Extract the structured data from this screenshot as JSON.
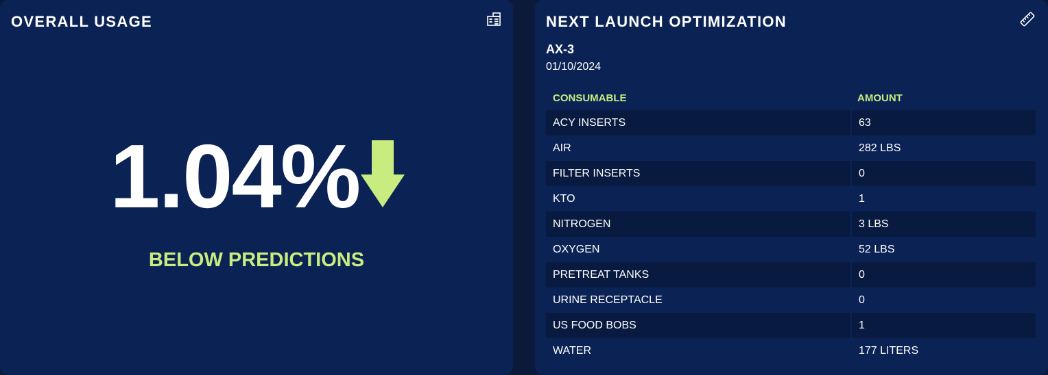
{
  "usage": {
    "title": "OVERALL USAGE",
    "icon": "report-icon",
    "value": "1.04%",
    "trend": "down",
    "status": "BELOW PREDICTIONS",
    "accent_color": "#c8ec7f"
  },
  "launch": {
    "title": "NEXT LAUNCH OPTIMIZATION",
    "icon": "ruler-icon",
    "mission": "AX-3",
    "date": "01/10/2024",
    "columns": [
      "CONSUMABLE",
      "AMOUNT"
    ],
    "rows": [
      [
        "ACY INSERTS",
        "63"
      ],
      [
        "AIR",
        "282 LBS"
      ],
      [
        "FILTER INSERTS",
        "0"
      ],
      [
        "KTO",
        "1"
      ],
      [
        "NITROGEN",
        "3 LBS"
      ],
      [
        "OXYGEN",
        "52 LBS"
      ],
      [
        "PRETREAT TANKS",
        "0"
      ],
      [
        "URINE RECEPTACLE",
        "0"
      ],
      [
        "US FOOD BOBS",
        "1"
      ],
      [
        "WATER",
        "177 LITERS"
      ]
    ]
  }
}
